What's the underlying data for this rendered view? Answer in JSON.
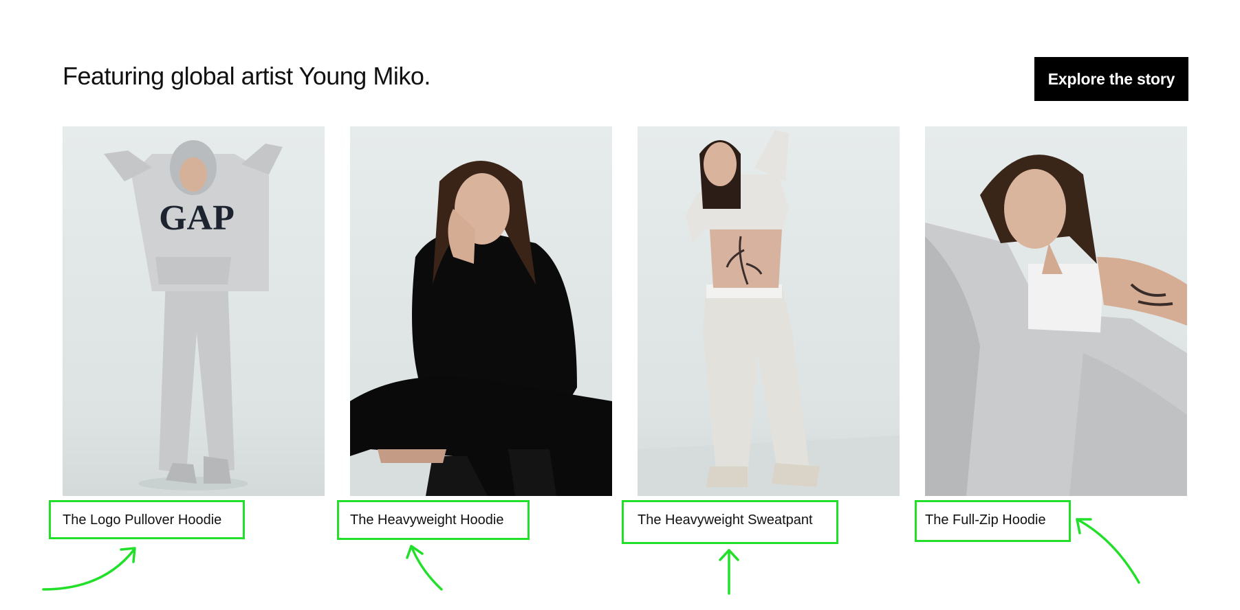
{
  "section": {
    "headline": "Featuring global artist Young Miko.",
    "cta_label": "Explore the story"
  },
  "products": [
    {
      "name": "The Logo Pullover Hoodie",
      "image_icon": "model-grey-gap-logo-hoodie-photo"
    },
    {
      "name": "The Heavyweight Hoodie",
      "image_icon": "model-black-hoodie-crouching-photo"
    },
    {
      "name": "The Heavyweight Sweatpant",
      "image_icon": "model-cream-sweatpant-photo"
    },
    {
      "name": "The Full-Zip Hoodie",
      "image_icon": "model-grey-full-zip-hoodie-photo"
    }
  ],
  "photo_print": "GAP",
  "colors": {
    "background": "#ffffff",
    "cta_background": "#000000",
    "cta_text": "#ffffff",
    "highlight": "#22e02a",
    "photo_backdrop": "#e2e8e8"
  }
}
